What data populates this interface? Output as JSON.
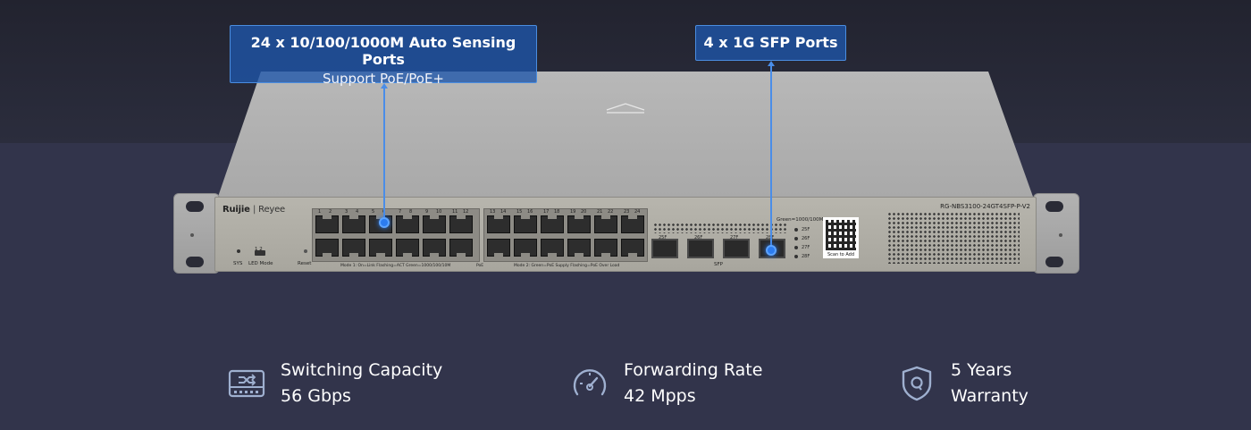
{
  "callouts": {
    "ports": {
      "line1": "24 x 10/100/1000M Auto Sensing Ports",
      "line2": "Support PoE/PoE+"
    },
    "sfp": {
      "line1": "4 x 1G SFP Ports"
    }
  },
  "device": {
    "brand": "Ruijie",
    "sub_brand": "Reyee",
    "model": "RG-NBS3100-24GT4SFP-P-V2",
    "labels": {
      "sys": "SYS",
      "led_mode": "LED Mode",
      "mode_nums": "1  2",
      "reset": "Reset",
      "mode1": "Mode 1: On=Link  Flashing=ACT  Green=1000/100/10M",
      "poe": "PoE",
      "mode2": "Mode 2: Green=PoE Supply  Flashing=PoE Over Load",
      "sfp": "SFP",
      "green_speed": "Green=1000/100M",
      "scan": "Scan to Add"
    },
    "ports_top": [
      "1",
      "2",
      "3",
      "4",
      "5",
      "6",
      "7",
      "8",
      "9",
      "10",
      "11",
      "12",
      "13",
      "14",
      "15",
      "16",
      "17",
      "18",
      "19",
      "20",
      "21",
      "22",
      "23",
      "24"
    ],
    "sfp_ports": [
      "25F",
      "26F",
      "27F",
      "28F"
    ]
  },
  "features": [
    {
      "icon": "switch-icon",
      "line1": "Switching Capacity",
      "line2": "56 Gbps"
    },
    {
      "icon": "speedometer-icon",
      "line1": "Forwarding Rate",
      "line2": "42 Mpps"
    },
    {
      "icon": "shield-warranty-icon",
      "line1": "5 Years",
      "line2": "Warranty"
    }
  ],
  "colors": {
    "background": "#31334a",
    "accent": "#2c7cf0",
    "callout": "#1e56aa"
  }
}
